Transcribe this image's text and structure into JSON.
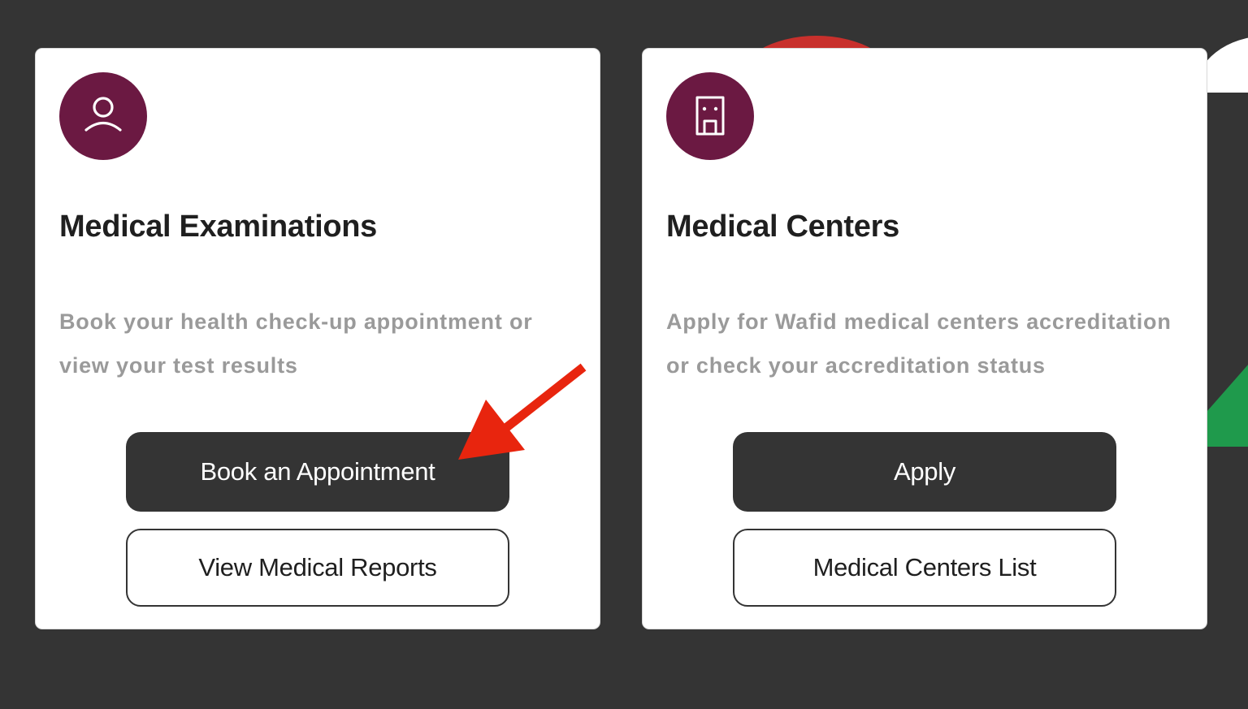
{
  "cards": [
    {
      "icon": "user-icon",
      "title": "Medical Examinations",
      "description": "Book your health check-up appointment or view your test results",
      "primary_label": "Book an Appointment",
      "secondary_label": "View Medical Reports"
    },
    {
      "icon": "building-icon",
      "title": "Medical Centers",
      "description": "Apply for Wafid medical centers accreditation or check your accreditation status",
      "primary_label": "Apply",
      "secondary_label": "Medical Centers List"
    }
  ],
  "colors": {
    "background": "#343434",
    "card": "#ffffff",
    "icon_circle": "#6b1942",
    "primary_button": "#343434",
    "annotation_arrow": "#e8250e"
  }
}
